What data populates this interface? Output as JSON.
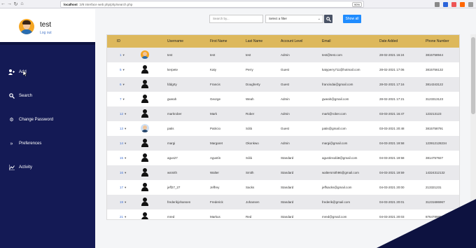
{
  "browser": {
    "url_host": "localhost",
    "url_path": ":3/8 interface web php/php/search.php",
    "zoom": "90%"
  },
  "sidebar": {
    "username": "test",
    "logout_label": "Log out",
    "items": [
      {
        "label": "Add",
        "icon": "add-user-icon"
      },
      {
        "label": "Search",
        "icon": "search-icon"
      },
      {
        "label": "Change Password",
        "icon": "gear-icon"
      },
      {
        "label": "Preferences",
        "icon": "double-chevron-icon"
      },
      {
        "label": "Activity",
        "icon": "chart-icon"
      }
    ]
  },
  "toolbar": {
    "search_placeholder": "Search by...",
    "filter_placeholder": "Select a filter",
    "search_button_icon": "search-icon",
    "show_all_label": "Show all"
  },
  "table": {
    "headers": [
      "ID",
      "Username",
      "First Name",
      "Last Name",
      "Account Level",
      "Email",
      "Date Added",
      "Phone Number"
    ],
    "rows": [
      {
        "id": "1",
        "avatar": "photo-orange",
        "username": "test",
        "first": "test",
        "last": "test",
        "level": "Admin",
        "email": "test@test.com",
        "date": "28-02-2021 16:24",
        "phone": "3815758944"
      },
      {
        "id": "5",
        "avatar": "silhouette",
        "username": "kerpete",
        "first": "Katy",
        "last": "Perry",
        "level": "Guest",
        "email": "katyperry711@hotmail.com",
        "date": "28-02-2021 17:06",
        "phone": "3815756132"
      },
      {
        "id": "6",
        "avatar": "silhouette",
        "username": "fddgrty",
        "first": "Francis",
        "last": "Dougherty",
        "level": "Guest",
        "email": "francisdai@gmail.com",
        "date": "28-02-2021 17:16",
        "phone": "3814343122"
      },
      {
        "id": "7",
        "avatar": "silhouette",
        "username": "gweah",
        "first": "George",
        "last": "Weah",
        "level": "Admin",
        "email": "gweah@gmail.com",
        "date": "28-02-2021 17:21",
        "phone": "3123313123"
      },
      {
        "id": "12",
        "avatar": "silhouette",
        "username": "markrober",
        "first": "Mark",
        "last": "Rober",
        "level": "Admin",
        "email": "mark@rober.com",
        "date": "03-03-2021 16:47",
        "phone": "123213123"
      },
      {
        "id": "13",
        "avatar": "photo-blue",
        "username": "patis",
        "first": "Patricio",
        "last": "Sólá",
        "level": "Guest",
        "email": "patis@gmail.com",
        "date": "03-03-2021 20:48",
        "phone": "3815758791"
      },
      {
        "id": "14",
        "avatar": "silhouette",
        "username": "margi",
        "first": "Margaret",
        "last": "Okonkwo",
        "level": "Admin",
        "email": "margi@gmail.com",
        "date": "04-03-2021 19:58",
        "phone": "123912128234"
      },
      {
        "id": "15",
        "avatar": "silhouette",
        "username": "agus27",
        "first": "Agustín",
        "last": "Sólá",
        "level": "Standard",
        "email": "agustinsolà8@gmail.com",
        "date": "04-03-2021 19:58",
        "phone": "3814757927"
      },
      {
        "id": "16",
        "avatar": "silhouette",
        "username": "wsmith",
        "first": "Walter",
        "last": "Smith",
        "level": "Standard",
        "email": "waltersmith96@gmail.com",
        "date": "04-03-2021 19:59",
        "phone": "14324312132"
      },
      {
        "id": "17",
        "avatar": "silhouette",
        "username": "jeff27_27",
        "first": "Jeffrey",
        "last": "Sacks",
        "level": "Standard",
        "email": "jeffsacks@gmail.com",
        "date": "04-03-2021 20:00",
        "phone": "213321231"
      },
      {
        "id": "19",
        "avatar": "silhouette",
        "username": "frederikjohansen",
        "first": "Frederick",
        "last": "Johansen",
        "level": "Standard",
        "email": "frederik@gmail.com",
        "date": "04-03-2021 20:01",
        "phone": "31231686967"
      },
      {
        "id": "21",
        "avatar": "silhouette",
        "username": "mred",
        "first": "Markus",
        "last": "Red",
        "level": "Standard",
        "email": "mred@gmail.com",
        "date": "04-03-2021 20:03",
        "phone": "876478989641"
      }
    ]
  }
}
